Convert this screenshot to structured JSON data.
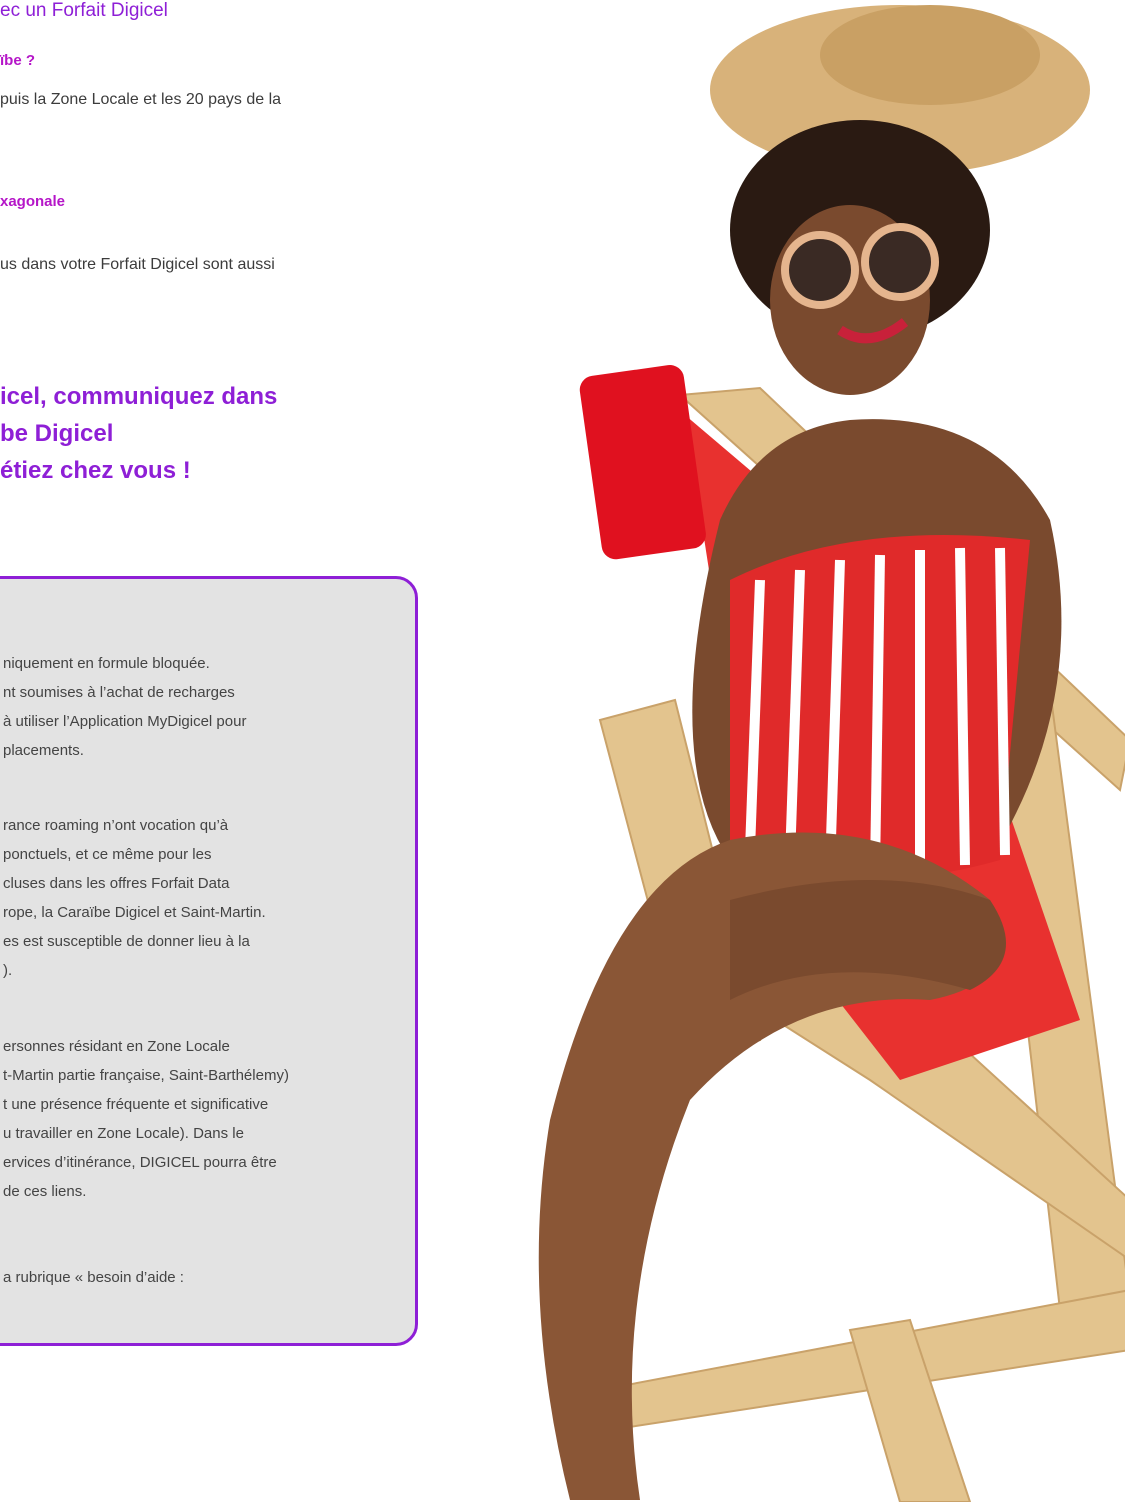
{
  "intro": "ec un Forfait Digicel",
  "sections": [
    {
      "heading": "ïbe ?",
      "lines": [
        "puis la Zone Locale et les 20 pays de la"
      ]
    },
    {
      "heading": "xagonale",
      "lines": [
        "us dans votre Forfait Digicel sont aussi"
      ]
    }
  ],
  "headline": [
    "icel, communiquez dans",
    "be Digicel",
    "étiez chez vous !"
  ],
  "notes": [
    "niquement en formule bloquée.",
    "nt soumises à l’achat de recharges",
    " à utiliser l’Application MyDigicel pour",
    "placements.",
    "rance roaming n’ont vocation qu’à",
    "ponctuels, et ce même pour les",
    "cluses dans les offres Forfait Data",
    "rope, la Caraïbe Digicel et Saint-Martin.",
    "es est susceptible de donner lieu à la",
    ").",
    "ersonnes résidant en Zone Locale",
    "t-Martin partie française, Saint-Barthélemy)",
    "t une présence fréquente et significative",
    "u travailler en Zone Locale). Dans le",
    "ervices d’itinérance, DIGICEL pourra être",
    " de ces liens.",
    "a rubrique « besoin d’aide :"
  ],
  "colors": {
    "accent": "#8e1fd6",
    "heading": "#b516c8",
    "box_bg": "#e3e3e3"
  }
}
